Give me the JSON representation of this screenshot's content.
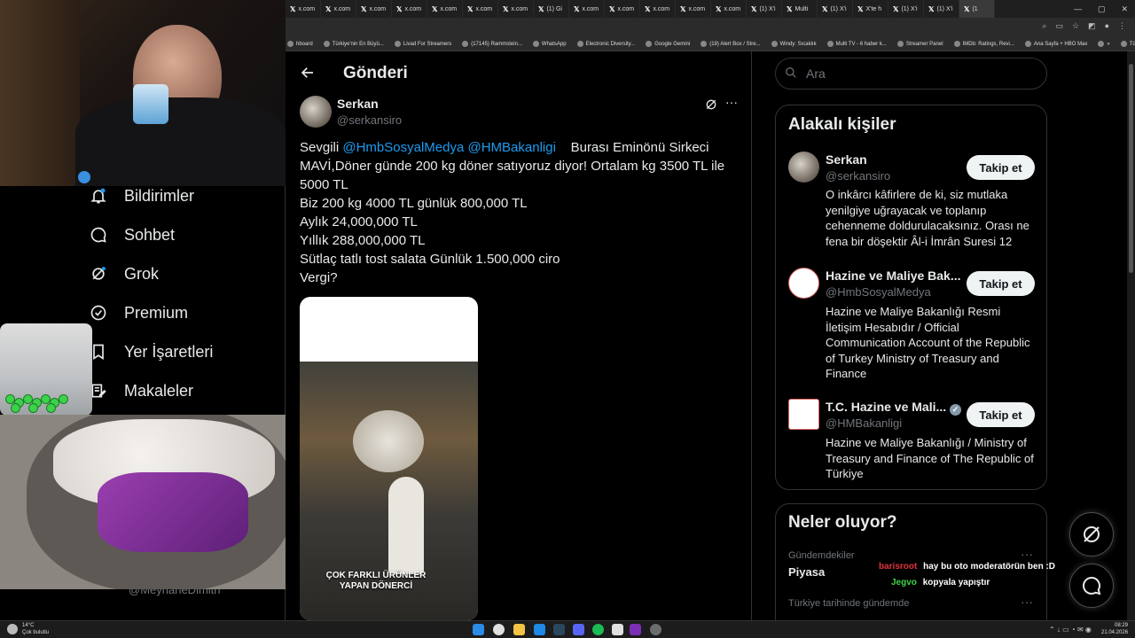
{
  "browser": {
    "tabs": [
      "x.com",
      "x.com",
      "x.com",
      "x.com",
      "x.com",
      "x.com",
      "x.com",
      "(1) Gi",
      "x.com",
      "x.com",
      "x.com",
      "x.com",
      "x.com",
      "(1) X'i",
      "Multi",
      "(1) X'i",
      "X'te h",
      "(1) X'i",
      "(1) X'i",
      "(1"
    ],
    "bookmarks": [
      "hboard",
      "Türkiye'nin En Büyü...",
      "Livad For Streamers",
      "(17145) Rammstein...",
      "WhatsApp",
      "Electronic Diversity...",
      "Google Gemini",
      "(19) Alert Box / Stre...",
      "Windy: Sıcaklık",
      "Multi TV - 6 haber k...",
      "Streamer Panel",
      "IMDb: Ratings, Revi...",
      "Ana Sayfa + HBO Max",
      "»",
      "Tüm Yer İşaretleri"
    ]
  },
  "leftnav": {
    "items": [
      {
        "label": "Bildirimler",
        "icon": "bell-icon"
      },
      {
        "label": "Sohbet",
        "icon": "chat-icon"
      },
      {
        "label": "Grok",
        "icon": "grok-icon"
      },
      {
        "label": "Premium",
        "icon": "verified-icon"
      },
      {
        "label": "Yer İşaretleri",
        "icon": "bookmark-icon"
      },
      {
        "label": "Makaleler",
        "icon": "article-icon"
      }
    ],
    "partial_handle": "@MeyhaneDimith"
  },
  "main": {
    "header_title": "Gönderi",
    "author_name": "Serkan",
    "author_handle": "@serkansiro",
    "tweet": {
      "line1_pre": "Sevgili ",
      "mention1": "@HmbSosyalMedya",
      "mention2": "@HMBakanligi",
      "line1_post": "    Burası Eminönü Sirkeci",
      "line2": "MAVİ,Döner günde 200 kg döner satıyoruz diyor! Ortalam kg 3500 TL ile",
      "line3": "5000 TL",
      "line4": "Biz 200 kg 4000 TL günlük 800,000 TL",
      "line5": "Aylık 24,000,000 TL",
      "line6": "Yıllık 288,000,000 TL",
      "line7": "Sütlaç tatlı tost salata Günlük 1.500,000 ciro",
      "line8": "Vergi?"
    },
    "media_caption_1": "ÇOK FARKLI ÜRÜNLER",
    "media_caption_2": "YAPAN DÖNERCİ"
  },
  "right": {
    "search_placeholder": "Ara",
    "related_title": "Alakalı kişiler",
    "people": [
      {
        "name": "Serkan",
        "handle": "@serkansiro",
        "button": "Takip et",
        "bio": "O inkârcı kâfirlere de ki, siz mutlaka yenilgiye uğrayacak ve toplanıp cehenneme doldurulacaksınız. Orası ne fena bir döşektir Âl-i İmrân Suresi 12"
      },
      {
        "name": "Hazine ve Maliye Bak...",
        "handle": "@HmbSosyalMedya",
        "button": "Takip et",
        "bio": "Hazine ve Maliye Bakanlığı Resmi İletişim Hesabıdır / Official Communication Account of the Republic of Turkey Ministry of Treasury and Finance"
      },
      {
        "name": "T.C. Hazine ve Mali...",
        "handle": "@HMBakanligi",
        "button": "Takip et",
        "bio": "Hazine ve Maliye Bakanlığı / Ministry of Treasury and Finance of The Republic of Türkiye"
      }
    ],
    "trends_title": "Neler oluyor?",
    "trends": [
      {
        "context": "Gündemdekiler",
        "topic": "Piyasa"
      },
      {
        "context": "Türkiye tarihinde gündemde",
        "topic": ""
      }
    ],
    "more": "···"
  },
  "chat": [
    {
      "user": "barisroot",
      "message": "hay bu oto moderatörün ben :D",
      "color": "#e0333e"
    },
    {
      "user": "Jegvo",
      "message": "kopyala yapıştır",
      "color": "#3ed34a"
    }
  ],
  "taskbar": {
    "weather_temp": "14°C",
    "weather_desc": "Çok bulutlu",
    "time": "08:29",
    "date": "21.04.2026"
  },
  "colors": {
    "accent": "#1d9bf0",
    "bg": "#000000",
    "muted": "#71767b"
  }
}
